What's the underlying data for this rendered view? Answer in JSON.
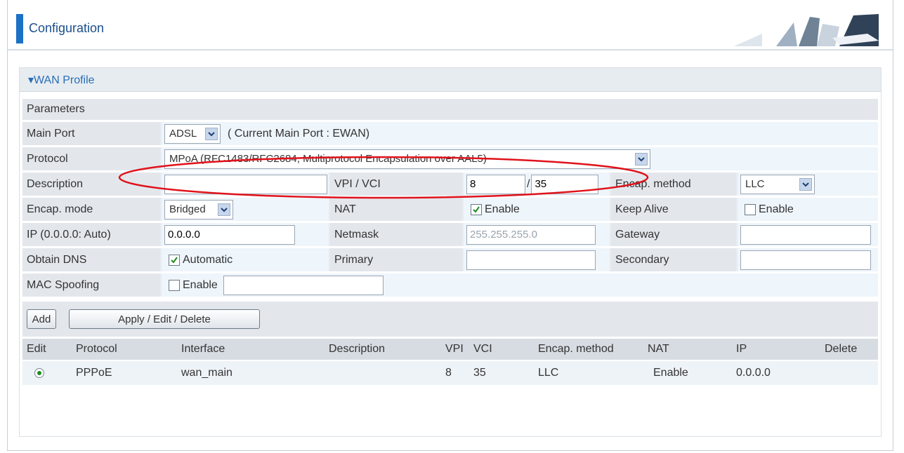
{
  "header": {
    "title": "Configuration"
  },
  "section": {
    "title": "▾WAN Profile"
  },
  "params": {
    "heading": "Parameters",
    "main_port": {
      "label": "Main Port",
      "value": "ADSL",
      "note": "( Current Main Port : EWAN)"
    },
    "protocol": {
      "label": "Protocol",
      "value": "MPoA (RFC1483/RFC2684, Multiprotocol Encapsulation over AAL5)"
    },
    "description": {
      "label": "Description",
      "value": ""
    },
    "vpi_vci": {
      "label": "VPI / VCI",
      "vpi": "8",
      "sep": "/",
      "vci": "35"
    },
    "encap_method": {
      "label": "Encap. method",
      "value": "LLC"
    },
    "encap_mode": {
      "label": "Encap. mode",
      "value": "Bridged"
    },
    "nat": {
      "label": "NAT",
      "option": "Enable",
      "checked": true
    },
    "keep_alive": {
      "label": "Keep Alive",
      "option": "Enable",
      "checked": false
    },
    "ip": {
      "label": "IP (0.0.0.0: Auto)",
      "value": "0.0.0.0"
    },
    "netmask": {
      "label": "Netmask",
      "value": "255.255.255.0"
    },
    "gateway": {
      "label": "Gateway",
      "value": ""
    },
    "obtain_dns": {
      "label": "Obtain DNS",
      "option": "Automatic",
      "checked": true
    },
    "primary": {
      "label": "Primary",
      "value": ""
    },
    "secondary": {
      "label": "Secondary",
      "value": ""
    },
    "mac_spoofing": {
      "label": "MAC Spoofing",
      "option": "Enable",
      "checked": false,
      "value": ""
    }
  },
  "buttons": {
    "add": "Add",
    "apply": "Apply / Edit / Delete"
  },
  "table": {
    "headers": [
      "Edit",
      "Protocol",
      "Interface",
      "Description",
      "VPI",
      "VCI",
      "Encap. method",
      "NAT",
      "IP",
      "Delete"
    ],
    "rows": [
      {
        "protocol": "PPPoE",
        "interface": "wan_main",
        "description": "",
        "vpi": "8",
        "vci": "35",
        "encap": "LLC",
        "nat": "Enable",
        "ip": "0.0.0.0",
        "delete": ""
      }
    ]
  },
  "colors": {
    "accent": "#1b71c6",
    "title": "#1a4f8b",
    "annotation": "#e0121b"
  },
  "icons": {
    "dropdown": "chevron-down-icon",
    "check": "checkmark-icon",
    "radio": "radio-selected-icon"
  }
}
